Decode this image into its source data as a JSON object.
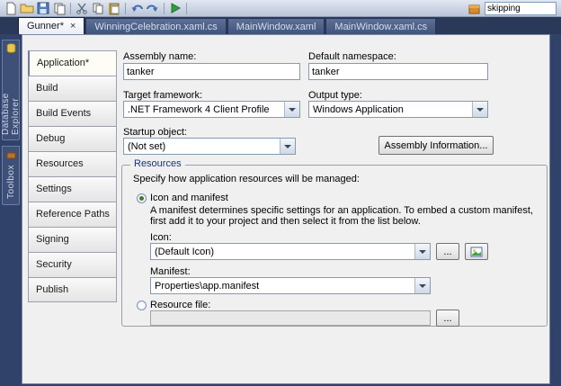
{
  "toolbar": {
    "icons": [
      {
        "name": "new-file"
      },
      {
        "name": "open-folder"
      },
      {
        "name": "save"
      },
      {
        "name": "save-all"
      },
      {
        "name": "cut"
      },
      {
        "name": "copy"
      },
      {
        "name": "paste"
      },
      {
        "name": "undo"
      },
      {
        "name": "redo"
      },
      {
        "name": "start-debug"
      }
    ],
    "search": {
      "icon": "package",
      "value": "skipping"
    }
  },
  "tab_bar": {
    "close_glyph": "×",
    "tabs": [
      {
        "label": "Gunner*",
        "active": true
      },
      {
        "label": "WinningCelebration.xaml.cs",
        "active": false
      },
      {
        "label": "MainWindow.xaml",
        "active": false
      },
      {
        "label": "MainWindow.xaml.cs",
        "active": false
      }
    ]
  },
  "side_strip": {
    "items": [
      {
        "label": "Database Explorer"
      },
      {
        "label": "Toolbox"
      }
    ]
  },
  "nav": {
    "items": [
      {
        "label": "Application*",
        "selected": true
      },
      {
        "label": "Build"
      },
      {
        "label": "Build Events"
      },
      {
        "label": "Debug"
      },
      {
        "label": "Resources"
      },
      {
        "label": "Settings"
      },
      {
        "label": "Reference Paths"
      },
      {
        "label": "Signing"
      },
      {
        "label": "Security"
      },
      {
        "label": "Publish"
      }
    ]
  },
  "form": {
    "assembly_name": {
      "label": "Assembly name:",
      "value": "tanker"
    },
    "default_namespace": {
      "label": "Default namespace:",
      "value": "tanker"
    },
    "target_framework": {
      "label": "Target framework:",
      "value": ".NET Framework 4 Client Profile"
    },
    "output_type": {
      "label": "Output type:",
      "value": "Windows Application"
    },
    "startup_object": {
      "label": "Startup object:",
      "value": "(Not set)"
    },
    "assembly_information_button": "Assembly Information...",
    "resources_group": {
      "title": "Resources",
      "description": "Specify how application resources will be managed:",
      "icon_and_manifest": {
        "radio_label": "Icon and manifest",
        "description": "A manifest determines specific settings for an application. To embed a custom manifest, first add it to your project and then select it from the list below.",
        "icon": {
          "label": "Icon:",
          "value": "(Default Icon)"
        },
        "manifest": {
          "label": "Manifest:",
          "value": "Properties\\app.manifest"
        }
      },
      "resource_file": {
        "radio_label": "Resource file:",
        "value": ""
      },
      "browse_button": "..."
    }
  }
}
